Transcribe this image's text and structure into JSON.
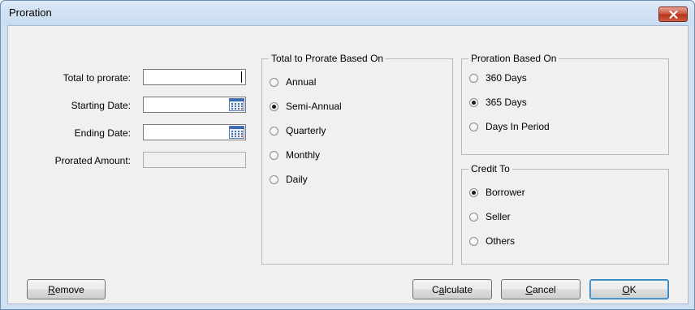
{
  "window": {
    "title": "Proration"
  },
  "fields": {
    "total_label": "Total to prorate:",
    "total_value": "",
    "start_label": "Starting Date:",
    "start_value": "",
    "end_label": "Ending Date:",
    "end_value": "",
    "prorated_label": "Prorated Amount:",
    "prorated_value": ""
  },
  "based_on": {
    "title": "Total to Prorate Based On",
    "options": [
      {
        "label": "Annual",
        "selected": false
      },
      {
        "label": "Semi-Annual",
        "selected": true
      },
      {
        "label": "Quarterly",
        "selected": false
      },
      {
        "label": "Monthly",
        "selected": false
      },
      {
        "label": "Daily",
        "selected": false
      }
    ]
  },
  "proration_based": {
    "title": "Proration Based On",
    "options": [
      {
        "label": "360 Days",
        "selected": false
      },
      {
        "label": "365 Days",
        "selected": true
      },
      {
        "label": "Days In Period",
        "selected": false
      }
    ]
  },
  "credit_to": {
    "title": "Credit To",
    "options": [
      {
        "label": "Borrower",
        "selected": true
      },
      {
        "label": "Seller",
        "selected": false
      },
      {
        "label": "Others",
        "selected": false
      }
    ]
  },
  "buttons": {
    "remove": {
      "label": "Remove",
      "mnemonic": "R",
      "rest": "emove"
    },
    "calculate": {
      "label": "Calculate",
      "prefix": "C",
      "mnemonic": "a",
      "rest": "lculate"
    },
    "cancel": {
      "label": "Cancel",
      "mnemonic": "C",
      "rest": "ancel"
    },
    "ok": {
      "label": "OK",
      "mnemonic": "O",
      "rest": "K"
    }
  },
  "icons": {
    "close": "close-icon",
    "calendar": "calendar-icon",
    "radio": "radio-button"
  },
  "colors": {
    "client_bg": "#f0f0f0",
    "close_red": "#c9513a",
    "titlebar": "#dbe8f6",
    "default_border": "#3c7fb1"
  }
}
